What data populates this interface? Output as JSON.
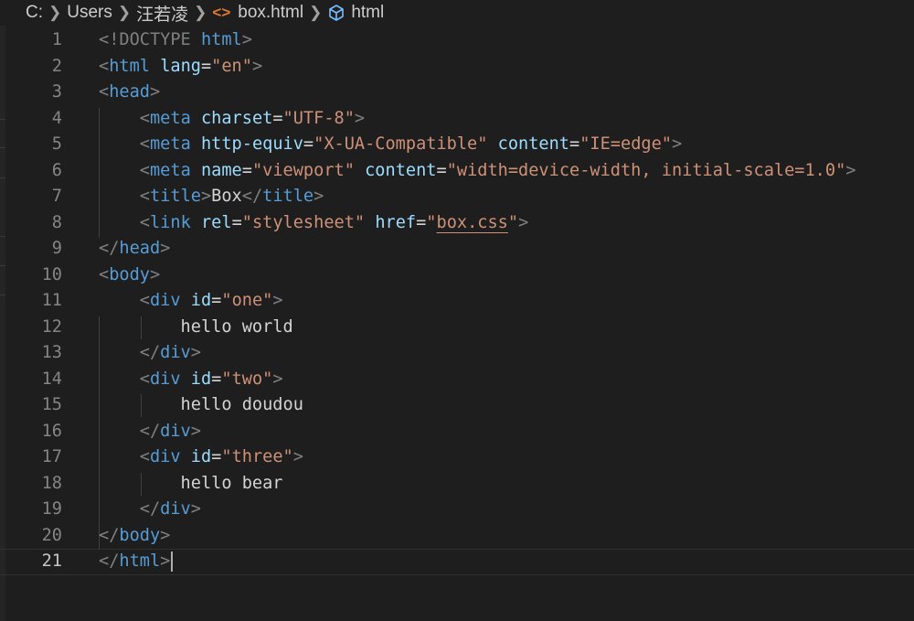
{
  "breadcrumb": {
    "items": [
      "C:",
      "Users",
      "汪若凌",
      "box.html",
      "html"
    ],
    "file_icon": "html-file-icon",
    "symbol_icon": "cube-icon"
  },
  "editor": {
    "current_line": 21,
    "lines": [
      {
        "n": "1",
        "tokens": [
          [
            "tag-b",
            "<!DOCTYPE "
          ],
          [
            "tag",
            "html"
          ],
          [
            "tag-b",
            ">"
          ]
        ]
      },
      {
        "n": "2",
        "tokens": [
          [
            "tag-b",
            "<"
          ],
          [
            "tag",
            "html"
          ],
          [
            "txt",
            " "
          ],
          [
            "attr",
            "lang"
          ],
          [
            "txt",
            "="
          ],
          [
            "str",
            "\"en\""
          ],
          [
            "tag-b",
            ">"
          ]
        ]
      },
      {
        "n": "3",
        "tokens": [
          [
            "tag-b",
            "<"
          ],
          [
            "tag",
            "head"
          ],
          [
            "tag-b",
            ">"
          ]
        ]
      },
      {
        "n": "4",
        "tokens": [
          [
            "txt",
            "    "
          ],
          [
            "tag-b",
            "<"
          ],
          [
            "tag",
            "meta"
          ],
          [
            "txt",
            " "
          ],
          [
            "attr",
            "charset"
          ],
          [
            "txt",
            "="
          ],
          [
            "str",
            "\"UTF-8\""
          ],
          [
            "tag-b",
            ">"
          ]
        ]
      },
      {
        "n": "5",
        "tokens": [
          [
            "txt",
            "    "
          ],
          [
            "tag-b",
            "<"
          ],
          [
            "tag",
            "meta"
          ],
          [
            "txt",
            " "
          ],
          [
            "attr",
            "http-equiv"
          ],
          [
            "txt",
            "="
          ],
          [
            "str",
            "\"X-UA-Compatible\""
          ],
          [
            "txt",
            " "
          ],
          [
            "attr",
            "content"
          ],
          [
            "txt",
            "="
          ],
          [
            "str",
            "\"IE=edge\""
          ],
          [
            "tag-b",
            ">"
          ]
        ]
      },
      {
        "n": "6",
        "tokens": [
          [
            "txt",
            "    "
          ],
          [
            "tag-b",
            "<"
          ],
          [
            "tag",
            "meta"
          ],
          [
            "txt",
            " "
          ],
          [
            "attr",
            "name"
          ],
          [
            "txt",
            "="
          ],
          [
            "str",
            "\"viewport\""
          ],
          [
            "txt",
            " "
          ],
          [
            "attr",
            "content"
          ],
          [
            "txt",
            "="
          ],
          [
            "str",
            "\"width=device-width, initial-scale=1.0\""
          ],
          [
            "tag-b",
            ">"
          ]
        ]
      },
      {
        "n": "7",
        "tokens": [
          [
            "txt",
            "    "
          ],
          [
            "tag-b",
            "<"
          ],
          [
            "tag",
            "title"
          ],
          [
            "tag-b",
            ">"
          ],
          [
            "txt",
            "Box"
          ],
          [
            "tag-b",
            "</"
          ],
          [
            "tag",
            "title"
          ],
          [
            "tag-b",
            ">"
          ]
        ]
      },
      {
        "n": "8",
        "tokens": [
          [
            "txt",
            "    "
          ],
          [
            "tag-b",
            "<"
          ],
          [
            "tag",
            "link"
          ],
          [
            "txt",
            " "
          ],
          [
            "attr",
            "rel"
          ],
          [
            "txt",
            "="
          ],
          [
            "str",
            "\"stylesheet\""
          ],
          [
            "txt",
            " "
          ],
          [
            "attr",
            "href"
          ],
          [
            "txt",
            "="
          ],
          [
            "str",
            "\""
          ],
          [
            "str link-str",
            "box.css"
          ],
          [
            "str",
            "\""
          ],
          [
            "tag-b",
            ">"
          ]
        ]
      },
      {
        "n": "9",
        "tokens": [
          [
            "tag-b",
            "</"
          ],
          [
            "tag",
            "head"
          ],
          [
            "tag-b",
            ">"
          ]
        ]
      },
      {
        "n": "10",
        "tokens": [
          [
            "tag-b",
            "<"
          ],
          [
            "tag",
            "body"
          ],
          [
            "tag-b",
            ">"
          ]
        ]
      },
      {
        "n": "11",
        "tokens": [
          [
            "txt",
            "    "
          ],
          [
            "tag-b",
            "<"
          ],
          [
            "tag",
            "div"
          ],
          [
            "txt",
            " "
          ],
          [
            "attr",
            "id"
          ],
          [
            "txt",
            "="
          ],
          [
            "str",
            "\"one\""
          ],
          [
            "tag-b",
            ">"
          ]
        ]
      },
      {
        "n": "12",
        "tokens": [
          [
            "txt",
            "        hello world"
          ]
        ]
      },
      {
        "n": "13",
        "tokens": [
          [
            "txt",
            "    "
          ],
          [
            "tag-b",
            "</"
          ],
          [
            "tag",
            "div"
          ],
          [
            "tag-b",
            ">"
          ]
        ]
      },
      {
        "n": "14",
        "tokens": [
          [
            "txt",
            "    "
          ],
          [
            "tag-b",
            "<"
          ],
          [
            "tag",
            "div"
          ],
          [
            "txt",
            " "
          ],
          [
            "attr",
            "id"
          ],
          [
            "txt",
            "="
          ],
          [
            "str",
            "\"two\""
          ],
          [
            "tag-b",
            ">"
          ]
        ]
      },
      {
        "n": "15",
        "tokens": [
          [
            "txt",
            "        hello doudou"
          ]
        ]
      },
      {
        "n": "16",
        "tokens": [
          [
            "txt",
            "    "
          ],
          [
            "tag-b",
            "</"
          ],
          [
            "tag",
            "div"
          ],
          [
            "tag-b",
            ">"
          ]
        ]
      },
      {
        "n": "17",
        "tokens": [
          [
            "txt",
            "    "
          ],
          [
            "tag-b",
            "<"
          ],
          [
            "tag",
            "div"
          ],
          [
            "txt",
            " "
          ],
          [
            "attr",
            "id"
          ],
          [
            "txt",
            "="
          ],
          [
            "str",
            "\"three\""
          ],
          [
            "tag-b",
            ">"
          ]
        ]
      },
      {
        "n": "18",
        "tokens": [
          [
            "txt",
            "        hello bear"
          ]
        ]
      },
      {
        "n": "19",
        "tokens": [
          [
            "txt",
            "    "
          ],
          [
            "tag-b",
            "</"
          ],
          [
            "tag",
            "div"
          ],
          [
            "tag-b",
            ">"
          ]
        ]
      },
      {
        "n": "20",
        "tokens": [
          [
            "tag-b",
            "</"
          ],
          [
            "tag",
            "body"
          ],
          [
            "tag-b",
            ">"
          ]
        ]
      },
      {
        "n": "21",
        "tokens": [
          [
            "tag-b",
            "</"
          ],
          [
            "tag",
            "html"
          ],
          [
            "tag-b",
            ">"
          ]
        ]
      }
    ]
  }
}
